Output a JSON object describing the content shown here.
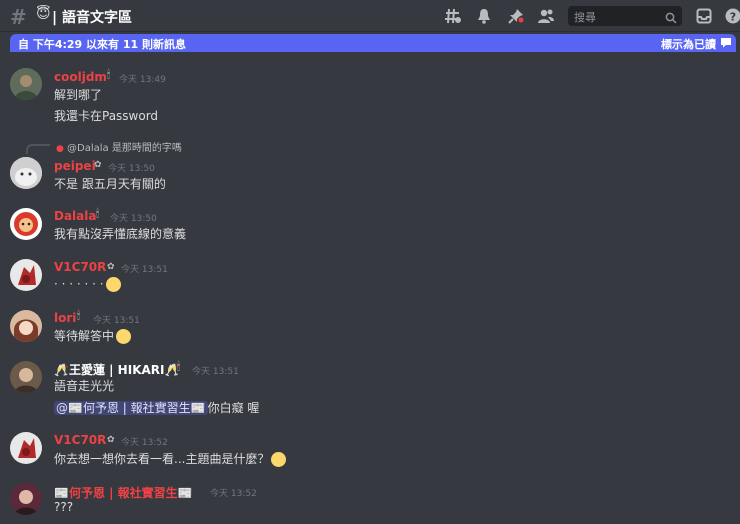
{
  "header": {
    "channel_emoji": "😇",
    "channel_name": "| 語音文字區",
    "search_placeholder": "搜尋"
  },
  "new_bar": {
    "text": "自 下午4:29 以來有 11 則新訊息",
    "action": "標示為已讀"
  },
  "colors": {
    "background": "#36393f",
    "accent": "#5865f2",
    "red_name": "#ed4245",
    "mention_bg": "#414675"
  },
  "messages": [
    {
      "user": "cooljdm",
      "time": "今天 13:49",
      "lines": [
        "解到哪了",
        "我還卡在Password"
      ]
    },
    {
      "reply": "@Dalala 是那時間的字嗎",
      "user": "peipei",
      "time": "今天 13:50",
      "lines": [
        "不是  跟五月天有關的"
      ]
    },
    {
      "user": "Dalala",
      "time": "今天 13:50",
      "lines": [
        "我有點沒弄懂底線的意義"
      ]
    },
    {
      "user": "V1C70R",
      "time": "今天 13:51",
      "lines": [
        "· · · · · · ·"
      ]
    },
    {
      "user": "lori",
      "time": "今天 13:51",
      "lines": [
        "等待解答中"
      ]
    },
    {
      "user": "🥂王愛蓮 | HIKARI🥂",
      "time": "今天 13:51",
      "lines": [
        "語音走光光"
      ],
      "mention": "@📰何予恩 | 報社實習生📰",
      "after_mention": "你白癡 喔"
    },
    {
      "user": "V1C70R",
      "time": "今天 13:52",
      "lines": [
        "你去想一想你去看一看...主題曲是什麼？"
      ]
    },
    {
      "user": "📰何予恩 | 報社實習生📰",
      "time": "今天 13:52",
      "lines": [
        "???"
      ]
    }
  ]
}
